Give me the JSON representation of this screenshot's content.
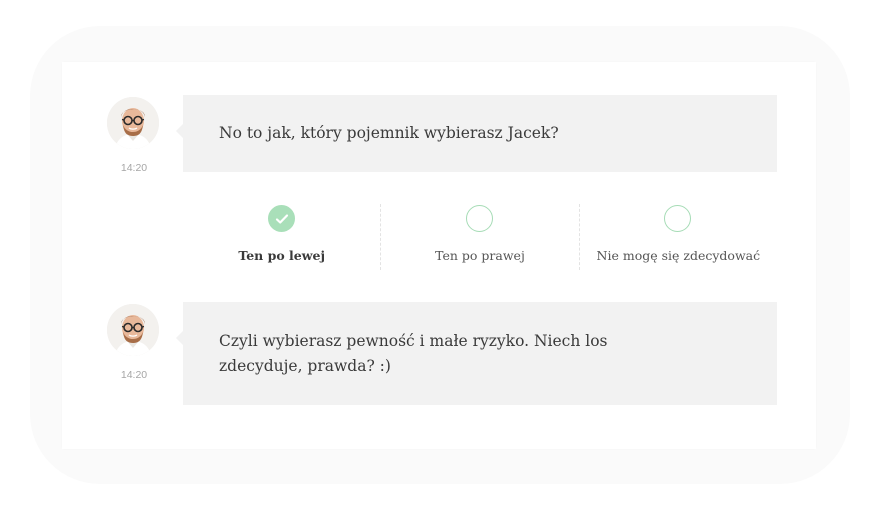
{
  "messages": [
    {
      "text": "No to jak, który pojemnik wybierasz Jacek?",
      "time": "14:20"
    },
    {
      "text": "Czyli wybierasz pewność i małe ryzyko. Niech los zdecyduje, prawda? :)",
      "time": "14:20"
    }
  ],
  "options": [
    {
      "label": "Ten po lewej",
      "selected": true
    },
    {
      "label": "Ten po prawej",
      "selected": false
    },
    {
      "label": "Nie mogę się zdecydować",
      "selected": false
    }
  ],
  "colors": {
    "accent_green": "#a9dfb9",
    "bubble_bg": "#f2f2f2",
    "text": "#3a3a3a",
    "timestamp": "#a6a6a6"
  },
  "icons": {
    "avatar": "person-avatar",
    "check": "check-icon"
  }
}
